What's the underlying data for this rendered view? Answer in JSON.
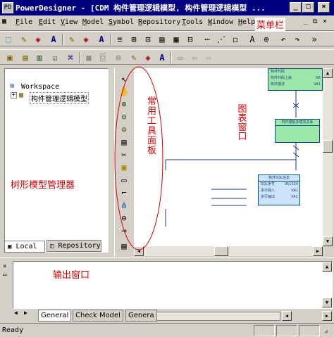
{
  "window": {
    "title": "PowerDesigner - [CDM 构件管理逻辑模型, 构件管理逻辑模型 ...",
    "app_icon": "PD"
  },
  "menu": {
    "items": [
      "File",
      "Edit",
      "View",
      "Model",
      "Symbol",
      "Repository",
      "Tools",
      "Window",
      "Help"
    ],
    "annotation": "菜单栏"
  },
  "browser": {
    "root": "Workspace",
    "model": "构件管理逻辑模型",
    "annotation": "树形模型管理器",
    "tabs": [
      "Local",
      "Repository"
    ]
  },
  "palette": {
    "annotation": "常用工具面板"
  },
  "diagram": {
    "annotation": "图表窗口",
    "entities": [
      {
        "rows": [
          "构件代码",
          "构件代码上级",
          "构件描述"
        ],
        "types": [
          "",
          "N5",
          "VA1"
        ]
      },
      {
        "header": "构件模板多模块关系"
      },
      {
        "header": "构件SQL信息",
        "rows": [
          "SQL序号",
          "多行输入",
          "多行输出"
        ],
        "types": [
          "VA1024",
          "VA1",
          "VA1"
        ]
      }
    ]
  },
  "output": {
    "annotation": "输出窗口",
    "tabs": [
      "General",
      "Check Model",
      "Genera"
    ]
  },
  "status": {
    "text": "Ready"
  },
  "colors": {
    "titlebar": "#000080",
    "annotation": "#d40000",
    "entity_green": "#9be8a8",
    "entity_blue": "#cce4f7"
  }
}
